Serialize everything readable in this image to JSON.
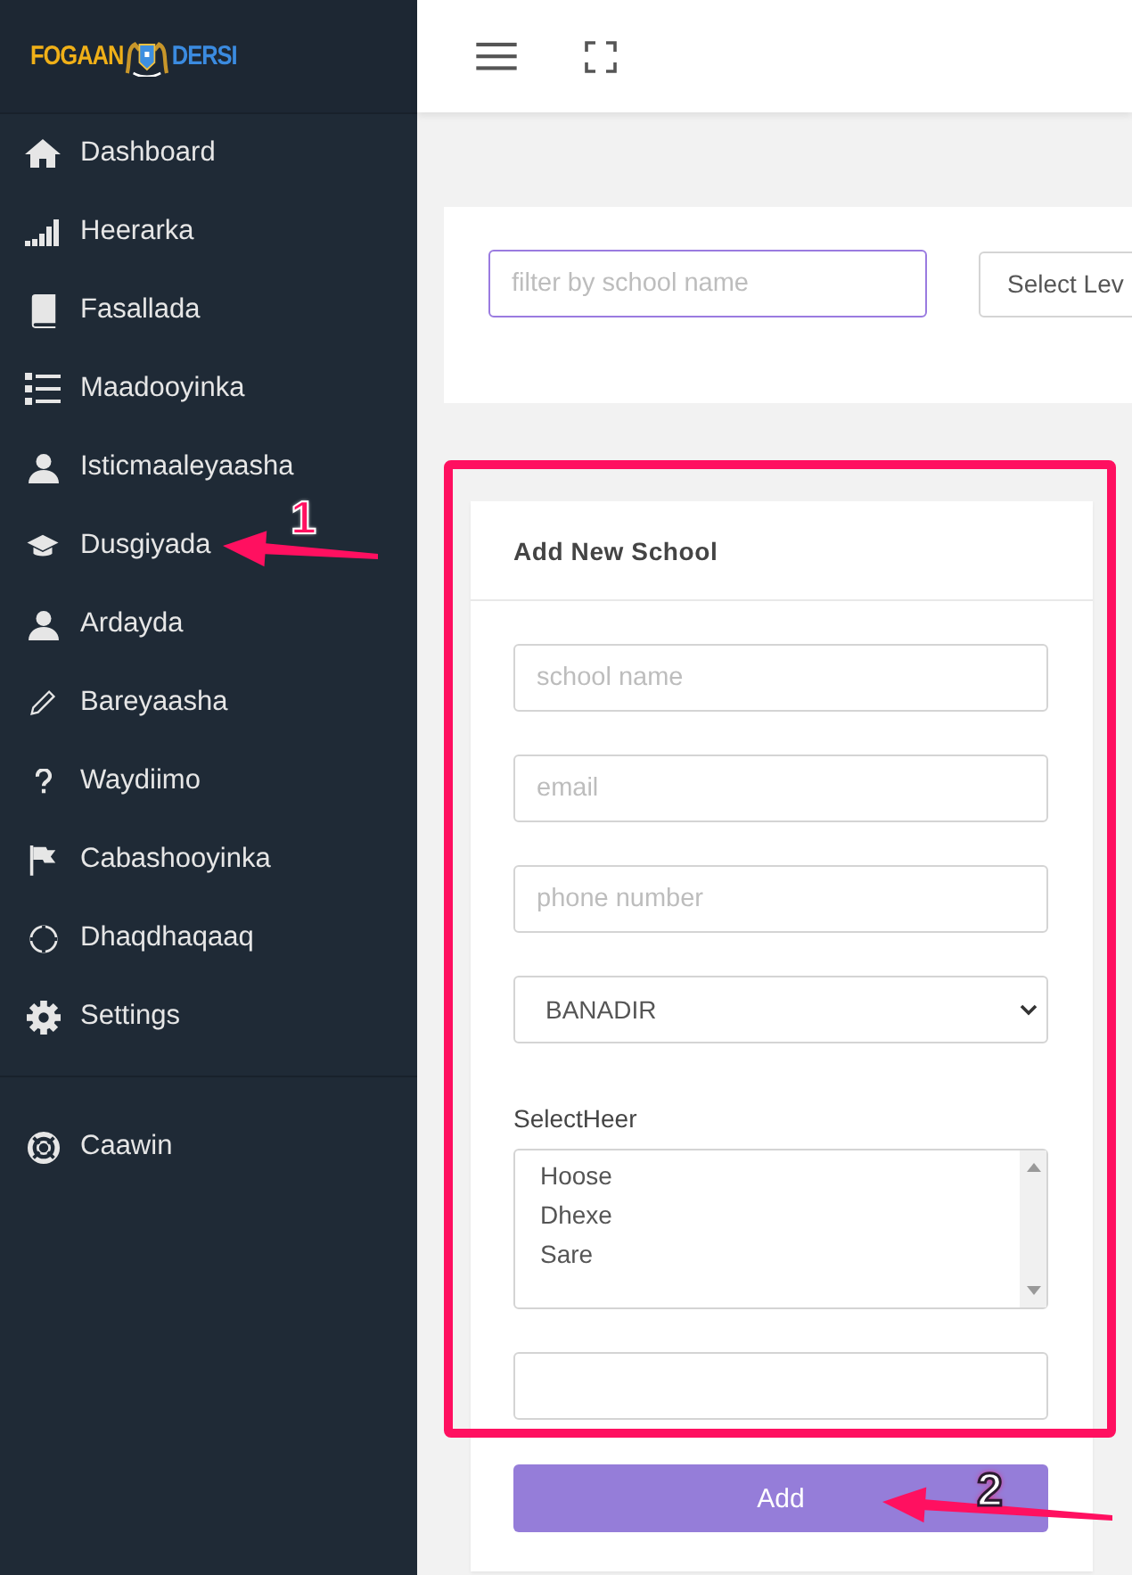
{
  "logo": {
    "left": "FOGAAN",
    "right": "DERSI"
  },
  "sidebar": {
    "items": [
      {
        "label": "Dashboard"
      },
      {
        "label": "Heerarka"
      },
      {
        "label": "Fasallada"
      },
      {
        "label": "Maadooyinka"
      },
      {
        "label": "Isticmaaleyaasha"
      },
      {
        "label": "Dusgiyada"
      },
      {
        "label": "Ardayda"
      },
      {
        "label": "Bareyaasha"
      },
      {
        "label": "Waydiimo"
      },
      {
        "label": "Cabashooyinka"
      },
      {
        "label": "Dhaqdhaqaaq"
      },
      {
        "label": "Settings"
      }
    ],
    "footer_items": [
      {
        "label": "Caawin"
      }
    ]
  },
  "filter": {
    "search": {
      "placeholder": "filter by school name"
    },
    "level_select": {
      "value": "Select Lev"
    }
  },
  "form": {
    "title": "Add New School",
    "fields": [
      {
        "kind": "input",
        "placeholder": "school name"
      },
      {
        "kind": "input",
        "placeholder": "email"
      },
      {
        "kind": "input",
        "placeholder": "phone number"
      },
      {
        "kind": "select",
        "value": "BANADIR"
      },
      {
        "kind": "listbox",
        "label": "SelectHeer",
        "options": [
          "Hoose",
          "Dhexe",
          "Sare"
        ]
      },
      {
        "kind": "input"
      }
    ],
    "button": "Add"
  },
  "annotations": [
    {
      "label": "1"
    },
    {
      "label": "2"
    }
  ]
}
